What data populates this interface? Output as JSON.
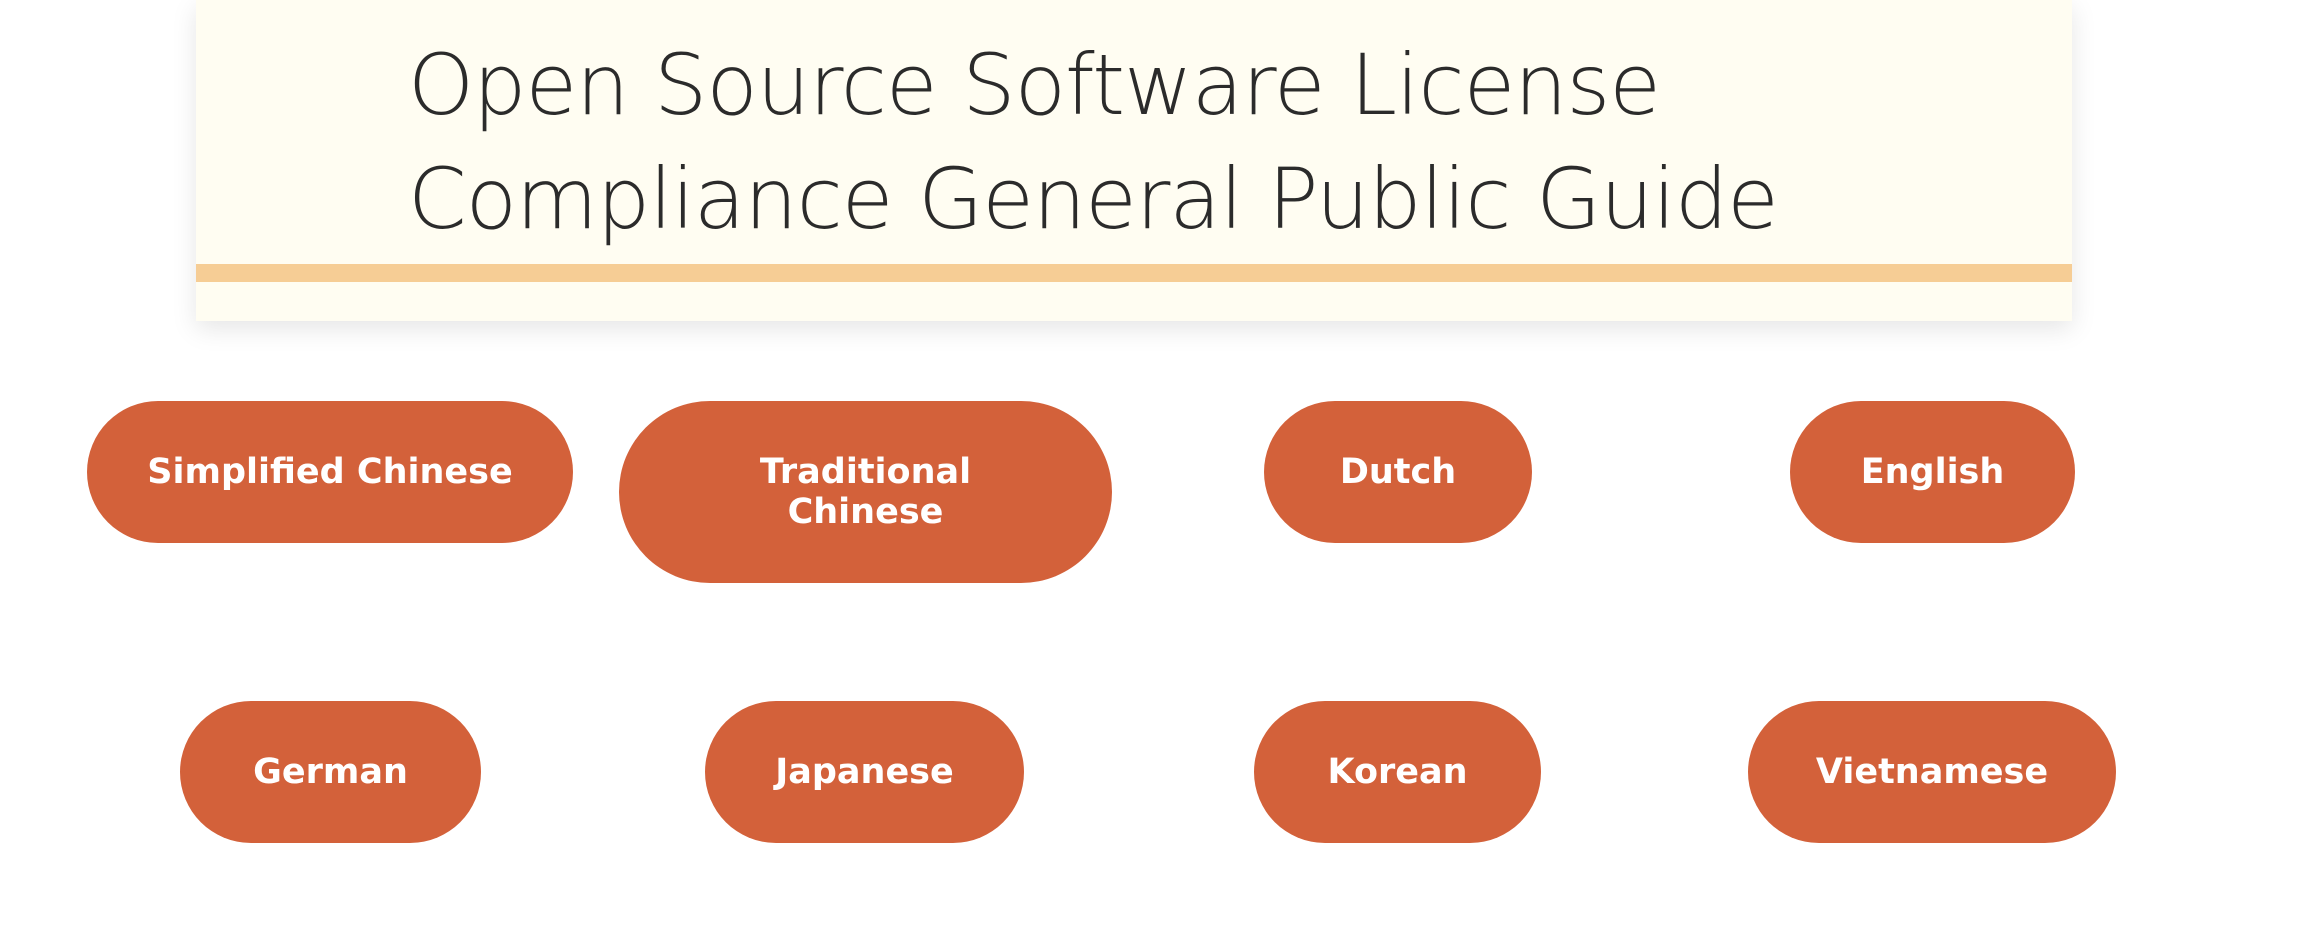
{
  "header": {
    "title": "Open Source Software License\nCompliance General Public Guide"
  },
  "languages": [
    {
      "label": "Simplified Chinese"
    },
    {
      "label": "Traditional Chinese"
    },
    {
      "label": "Dutch"
    },
    {
      "label": "English"
    },
    {
      "label": "German"
    },
    {
      "label": "Japanese"
    },
    {
      "label": "Korean"
    },
    {
      "label": "Vietnamese"
    }
  ],
  "colors": {
    "button": "#d3613a",
    "card": "#fffdf2",
    "rule": "#f6cd95",
    "text": "#2b2b2b"
  }
}
